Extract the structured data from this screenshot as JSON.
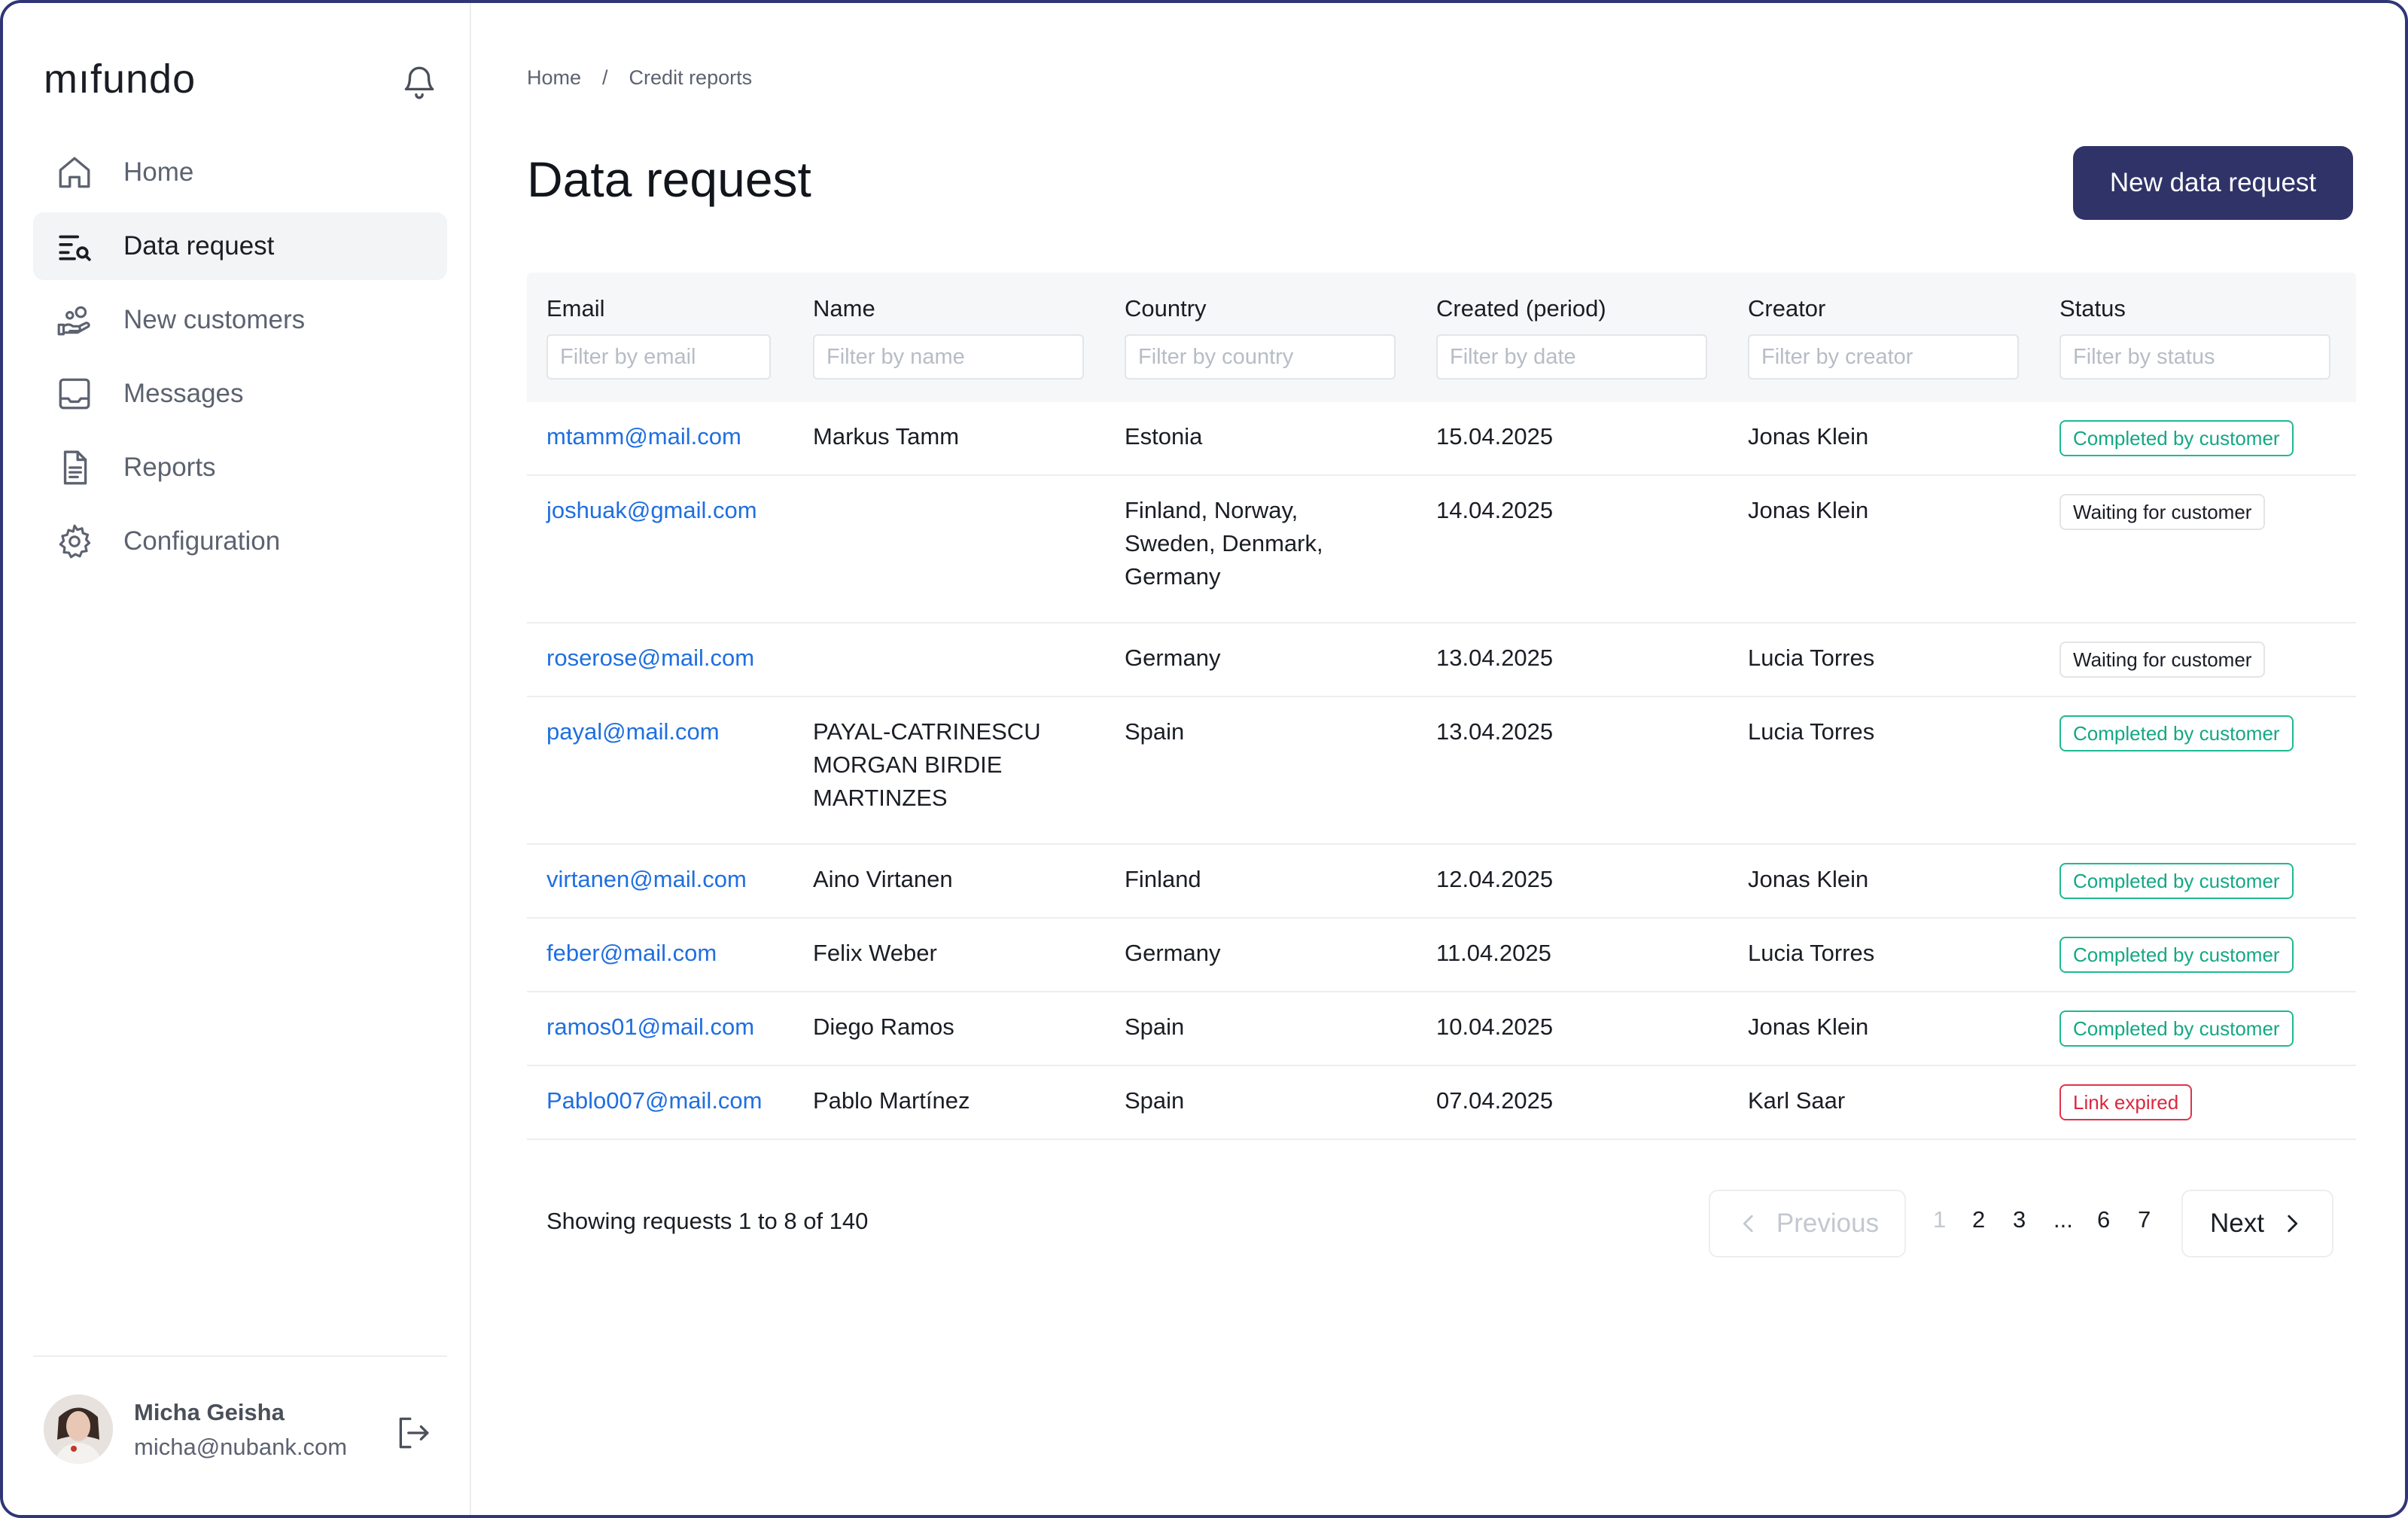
{
  "app": {
    "logo": "mıfundo"
  },
  "sidebar": {
    "items": [
      {
        "label": "Home",
        "icon": "home-icon"
      },
      {
        "label": "Data request",
        "icon": "list-search-icon",
        "active": true
      },
      {
        "label": "New customers",
        "icon": "hand-coins-icon"
      },
      {
        "label": "Messages",
        "icon": "inbox-icon"
      },
      {
        "label": "Reports",
        "icon": "document-icon"
      },
      {
        "label": "Configuration",
        "icon": "gear-icon"
      }
    ],
    "user": {
      "name": "Micha Geisha",
      "email": "micha@nubank.com"
    }
  },
  "breadcrumb": {
    "home": "Home",
    "separator": "/",
    "current": "Credit reports"
  },
  "page": {
    "title": "Data request",
    "new_button": "New data request"
  },
  "table": {
    "columns": [
      "Email",
      "Name",
      "Country",
      "Created (period)",
      "Creator",
      "Status"
    ],
    "filters": [
      "Filter by email",
      "Filter by name",
      "Filter by country",
      "Filter by date",
      "Filter by creator",
      "Filter by status"
    ],
    "rows": [
      {
        "email": "mtamm@mail.com",
        "name": "Markus Tamm",
        "country": "Estonia",
        "created": "15.04.2025",
        "creator": "Jonas Klein",
        "status": "Completed by customer",
        "status_kind": "green"
      },
      {
        "email": "joshuak@gmail.com",
        "name": "",
        "country": "Finland, Norway,\nSweden, Denmark,\nGermany",
        "created": "14.04.2025",
        "creator": "Jonas Klein",
        "status": "Waiting for customer",
        "status_kind": "grey"
      },
      {
        "email": "roserose@mail.com",
        "name": "",
        "country": "Germany",
        "created": "13.04.2025",
        "creator": "Lucia Torres",
        "status": "Waiting for customer",
        "status_kind": "grey"
      },
      {
        "email": "payal@mail.com",
        "name": "PAYAL-CATRINESCU\nMORGAN BIRDIE\nMARTINZES",
        "country": "Spain",
        "created": "13.04.2025",
        "creator": "Lucia Torres",
        "status": "Completed by customer",
        "status_kind": "green"
      },
      {
        "email": "virtanen@mail.com",
        "name": "Aino Virtanen",
        "country": "Finland",
        "created": "12.04.2025",
        "creator": "Jonas Klein",
        "status": "Completed by customer",
        "status_kind": "green"
      },
      {
        "email": "feber@mail.com",
        "name": "Felix Weber",
        "country": "Germany",
        "created": "11.04.2025",
        "creator": "Lucia Torres",
        "status": "Completed by customer",
        "status_kind": "green"
      },
      {
        "email": "ramos01@mail.com",
        "name": "Diego Ramos",
        "country": "Spain",
        "created": "10.04.2025",
        "creator": "Jonas Klein",
        "status": "Completed by customer",
        "status_kind": "green"
      },
      {
        "email": "Pablo007@mail.com",
        "name": "Pablo Martínez",
        "country": "Spain",
        "created": "07.04.2025",
        "creator": "Karl Saar",
        "status": "Link expired",
        "status_kind": "red"
      }
    ]
  },
  "pagination": {
    "summary": "Showing requests 1 to 8 of 140",
    "previous": "Previous",
    "next": "Next",
    "pages": [
      "1",
      "2",
      "3",
      "...",
      "6",
      "7"
    ],
    "current_page": "1"
  },
  "colors": {
    "accent": "#2f3368",
    "link": "#1f6fe0",
    "completed": "#14a884",
    "expired": "#d9283f",
    "frame": "#2f3577"
  }
}
